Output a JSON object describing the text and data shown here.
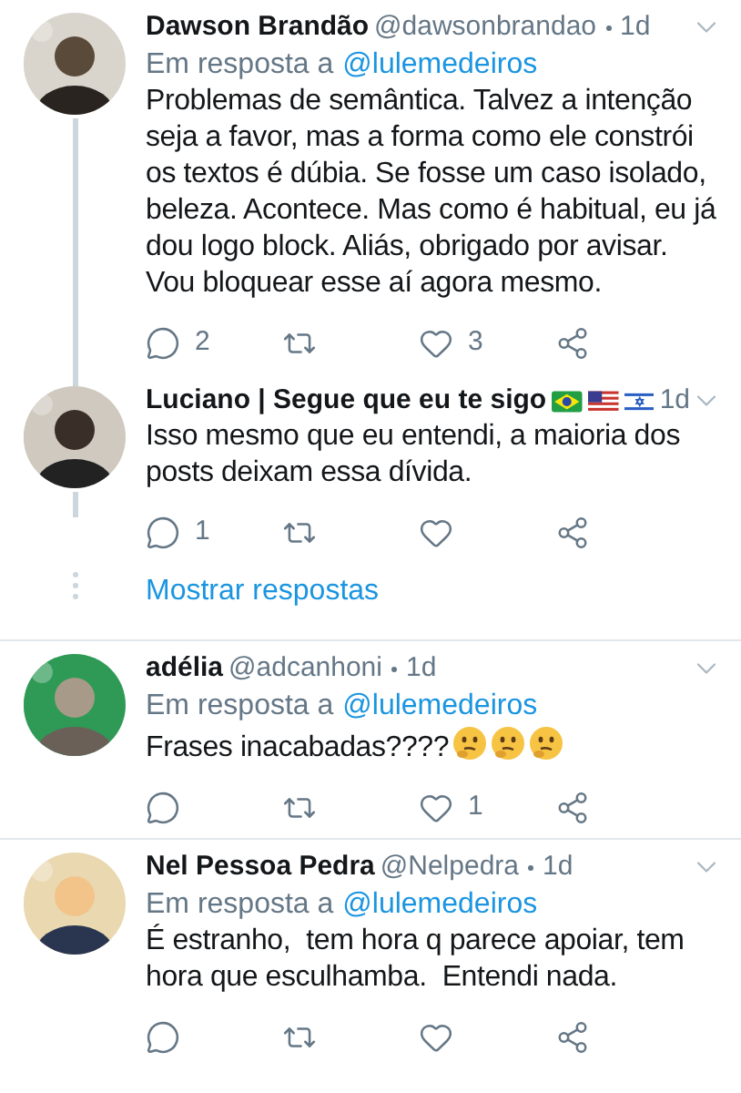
{
  "tweets": [
    {
      "name": "Dawson Brandão",
      "handle": "@dawsonbrandao",
      "time": "1d",
      "reply_prefix": "Em resposta a",
      "reply_to": "@lulemedeiros",
      "body": "Problemas de semântica. Talvez a intenção seja a favor, mas a forma como ele constrói os textos é dúbia. Se fosse um caso isolado, beleza. Acontece. Mas como é habitual, eu já dou logo block. Aliás, obrigado por avisar. Vou bloquear esse aí agora mesmo.",
      "replies": "2",
      "likes": "3",
      "connected_above": false,
      "connected_below": true,
      "avatar": {
        "kind": "picture"
      }
    },
    {
      "name": "Luciano | Segue que eu te sigo",
      "flags": [
        {
          "kind": "brazil"
        },
        {
          "kind": "usa"
        },
        {
          "kind": "israel"
        }
      ],
      "time": "1d",
      "body": "Isso mesmo que eu entendi, a maioria dos posts deixam essa dívida.",
      "replies": "1",
      "connected_above": true,
      "connected_below": false,
      "show_replies": "Mostrar respostas",
      "avatar": {
        "kind": "picture"
      }
    },
    {
      "name": "adélia",
      "handle": "@adcanhoni",
      "time": "1d",
      "reply_prefix": "Em resposta a",
      "reply_to": "@lulemedeiros",
      "body": "Frases inacabadas????",
      "inline_icons": [
        {
          "kind": "thinking"
        },
        {
          "kind": "thinking"
        },
        {
          "kind": "thinking"
        }
      ],
      "likes": "1",
      "connected_above": false,
      "connected_below": false,
      "avatar": {
        "kind": "picture"
      }
    },
    {
      "name": "Nel Pessoa Pedra",
      "handle": "@Nelpedra",
      "time": "1d",
      "reply_prefix": "Em resposta a",
      "reply_to": "@lulemedeiros",
      "body": "É estranho,  tem hora q parece apoiar, tem hora que esculhamba.  Entendi nada.",
      "connected_above": false,
      "connected_below": false,
      "avatar": {
        "kind": "picture"
      }
    }
  ]
}
